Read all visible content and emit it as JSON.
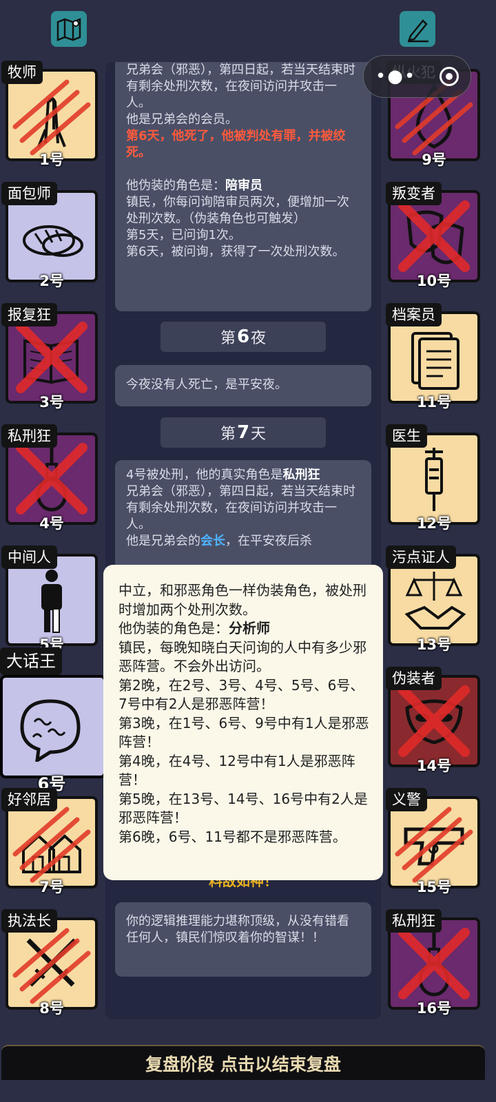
{
  "log_card1": {
    "line1": "兄弟会（邪恶），第四日起，若当天结束时有剩余处刑次数，在夜间访问并攻击一人。",
    "line2": "他是兄弟会的会员。",
    "death": "第6天，他死了，他被判处有罪，并被绞死。",
    "disguise_prefix": "他伪装的角色是：",
    "disguise_role": "陪审员",
    "disguise_desc": "镇民，你每问询陪审员两次，便增加一次处刑次数。（伪装角色也可触发）",
    "day5": "第5天，已问询1次。",
    "day6": "第6天，被问询，获得了一次处刑次数。"
  },
  "night6": {
    "prefix": "第",
    "number": "6",
    "suffix": "夜"
  },
  "night6_log": "今夜没有人死亡，是平安夜。",
  "day7": {
    "prefix": "第",
    "number": "7",
    "suffix": "天"
  },
  "log_card2": {
    "line1_prefix": "4号被处刑，他的真实角色是",
    "line1_role": "私刑狂",
    "line2": "兄弟会（邪恶），第四日起，若当天结束时有剩余处刑次数，在夜间访问并攻击一人。",
    "line3_prefix": "他是兄弟会的",
    "line3_role": "会长",
    "line3_suffix": "，在平安夜后杀"
  },
  "partial_banner": "料敌如神！",
  "final_log": "你的逻辑推理能力堪称顶级，从没有错看任何人，镇民们惊叹着你的智谋！！",
  "tooltip": {
    "line1": "中立，和邪恶角色一样伪装角色，被处刑时增加两个处刑次数。",
    "disguise_prefix": "他伪装的角色是：",
    "disguise_role": "分析师",
    "desc": "镇民，每晚知晓白天问询的人中有多少邪恶阵营。不会外出访问。",
    "n2": "第2晚，在2号、3号、4号、5号、6号、7号中有2人是邪恶阵营！",
    "n3": "第3晚，在1号、6号、9号中有1人是邪恶阵营！",
    "n4": "第4晚，在4号、12号中有1人是邪恶阵营！",
    "n5": "第5晚，在13号、14号、16号中有2人是邪恶阵营！",
    "n6": "第6晚，6号、11号都不是邪恶阵营。"
  },
  "players_left": [
    {
      "role": "牧师",
      "num": "1号",
      "icon": "praying-hands-icon",
      "color": "light",
      "mark": "claw"
    },
    {
      "role": "面包师",
      "num": "2号",
      "icon": "bread-icon",
      "color": "lav",
      "mark": "none"
    },
    {
      "role": "报复狂",
      "num": "3号",
      "icon": "book-icon",
      "color": "purple",
      "mark": "x"
    },
    {
      "role": "私刑狂",
      "num": "4号",
      "icon": "noose-icon",
      "color": "purple",
      "mark": "x"
    },
    {
      "role": "中间人",
      "num": "5号",
      "icon": "person-icon",
      "color": "lav",
      "mark": "none"
    },
    {
      "role": "大话王",
      "num": "6号",
      "icon": "speech-bubble-icon",
      "color": "lav",
      "mark": "none"
    },
    {
      "role": "好邻居",
      "num": "7号",
      "icon": "houses-icon",
      "color": "light",
      "mark": "claw"
    },
    {
      "role": "执法长",
      "num": "8号",
      "icon": "swords-icon",
      "color": "light",
      "mark": "claw"
    }
  ],
  "players_right": [
    {
      "role": "纵火犯",
      "num": "9号",
      "icon": "flame-icon",
      "color": "purple",
      "mark": "claw"
    },
    {
      "role": "叛变者",
      "num": "10号",
      "icon": "masks-icon",
      "color": "purple",
      "mark": "x"
    },
    {
      "role": "档案员",
      "num": "11号",
      "icon": "documents-icon",
      "color": "light",
      "mark": "none"
    },
    {
      "role": "医生",
      "num": "12号",
      "icon": "syringe-icon",
      "color": "light",
      "mark": "none"
    },
    {
      "role": "污点证人",
      "num": "13号",
      "icon": "scales-handshake-icon",
      "color": "light",
      "mark": "none"
    },
    {
      "role": "伪装者",
      "num": "14号",
      "icon": "mask-icon",
      "color": "maroon",
      "mark": "x"
    },
    {
      "role": "义警",
      "num": "15号",
      "icon": "gun-icon",
      "color": "light",
      "mark": "claw"
    },
    {
      "role": "私刑狂",
      "num": "16号",
      "icon": "noose-icon",
      "color": "purple",
      "mark": "x"
    }
  ],
  "bottom_button": "复盘阶段 点击以结束复盘"
}
